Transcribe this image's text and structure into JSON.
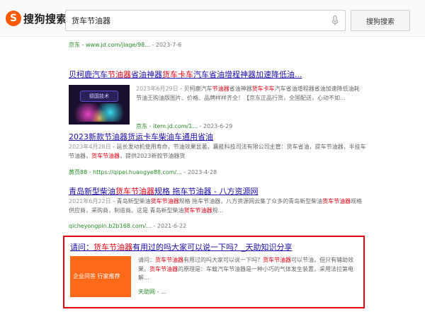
{
  "brand": {
    "logo_letter": "S",
    "name": "搜狗搜索",
    "accent": "#ff5a00"
  },
  "search": {
    "query": "货车节油器",
    "button_label": "搜狗搜索",
    "mic_icon": "microphone-icon"
  },
  "prev_result": {
    "url": "京东 - www.jd.com/jiage/98...",
    "date": " - 2023-7-6"
  },
  "results": [
    {
      "title_pre": "贝柯鹿汽车",
      "title_hl": "节油器",
      "title_mid": "省油神器",
      "title_hl2": "货车卡车",
      "title_post": "汽车省油增程神器加速降低油...",
      "thumb_text": "德国技术",
      "date": "2023年6月29日",
      "snippet_a": " - 贝柯鹿汽车",
      "snippet_hl_a": "节油器",
      "snippet_b": "省油神器",
      "snippet_hl_b": "货车卡车",
      "snippet_c": "汽车省油增程器省油加速降低油耗 节油王购油版图片、价格、品牌样样齐全！【京东正品行货，全国配送，心动不如...",
      "url": "京东 - item.jd.com/1...",
      "url_date": " - 2023-6-29"
    },
    {
      "title": "2023新款节油器货运卡车柴油车通用省油",
      "date": "2023年4月28日",
      "snippet_a": " - 延长发动机使用寿命，节油效果显著。襄能科技司法有限公司主管：货车省油，提车节油器，半挂车节油器，",
      "snippet_hl": "货车节油器",
      "snippet_b": "，提供2023新款节油器货",
      "url": "黄页88 - https://qipei.huangye88.com/...",
      "url_date": " - 2023-4-28"
    },
    {
      "title_pre": "青岛新型柴油",
      "title_hl": "货车节油器",
      "title_post": "规格 拖车节油器 - 八方资源网",
      "date": "2021年6月22日",
      "snippet_a": " - 青岛新型柴油",
      "snippet_hl_a": "货车节油器",
      "snippet_b": "规格 拖车节油器，八方资源网云集了众多的青岛新型柴油",
      "snippet_hl_b": "货车节油器",
      "snippet_c": "规格供应商，采购商，制造商。这是 青岛新型柴油",
      "snippet_hl_c": "货车节油器",
      "snippet_d": "规...",
      "url": "qicheyongpin.b2b168.com/...",
      "url_date": " - 2021-6-22"
    },
    {
      "title_pre": "请问：",
      "title_hl": "货车节油器",
      "title_post": "有用过的吗大家可以说一下吗？_天助知识分享",
      "tag": "企业问答 行家推荐",
      "snippet_a": "请问：",
      "snippet_hl_a": "货车节油器",
      "snippet_b": "有用过的吗大家可以说一下吗？",
      "snippet_hl_b": "货车节油器",
      "snippet_c": "可以节油，但只有辅助效果。",
      "snippet_hl_c": "货车节油器",
      "snippet_d": "的原理是：车载汽车节油器是一种小巧的气体发生装置，采用法拉第电解...",
      "url": "天助网 - ..."
    }
  ]
}
